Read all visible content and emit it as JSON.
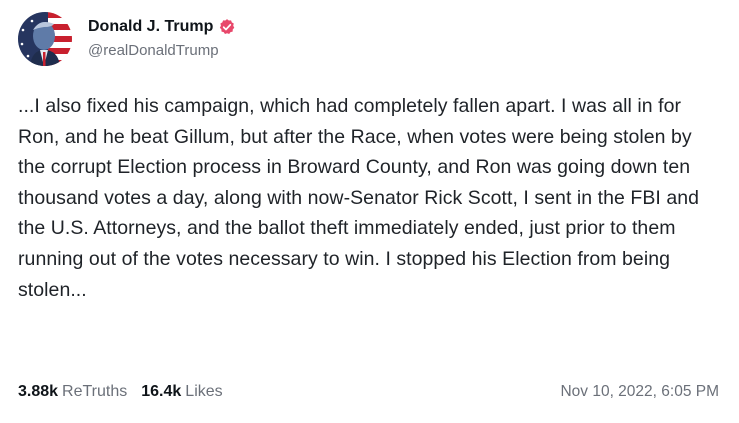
{
  "author": {
    "display_name": "Donald J. Trump",
    "handle": "@realDonaldTrump",
    "verified_color": "#e8486b"
  },
  "post": {
    "text": "...I also fixed his campaign, which had completely fallen apart. I was all in for Ron, and he beat Gillum, but after the Race, when votes were being stolen by the corrupt Election process in Broward County, and Ron was going down ten thousand votes a day, along with now-Senator Rick Scott, I sent in the FBI and the U.S. Attorneys, and the ballot theft immediately ended, just prior to them running out of the votes necessary to win. I stopped his Election from being stolen...",
    "retruths_count": "3.88k",
    "retruths_label": "ReTruths",
    "likes_count": "16.4k",
    "likes_label": "Likes",
    "timestamp": "Nov 10, 2022, 6:05 PM"
  },
  "icons": {
    "verified": "verified-badge-icon",
    "avatar": "profile-avatar"
  }
}
